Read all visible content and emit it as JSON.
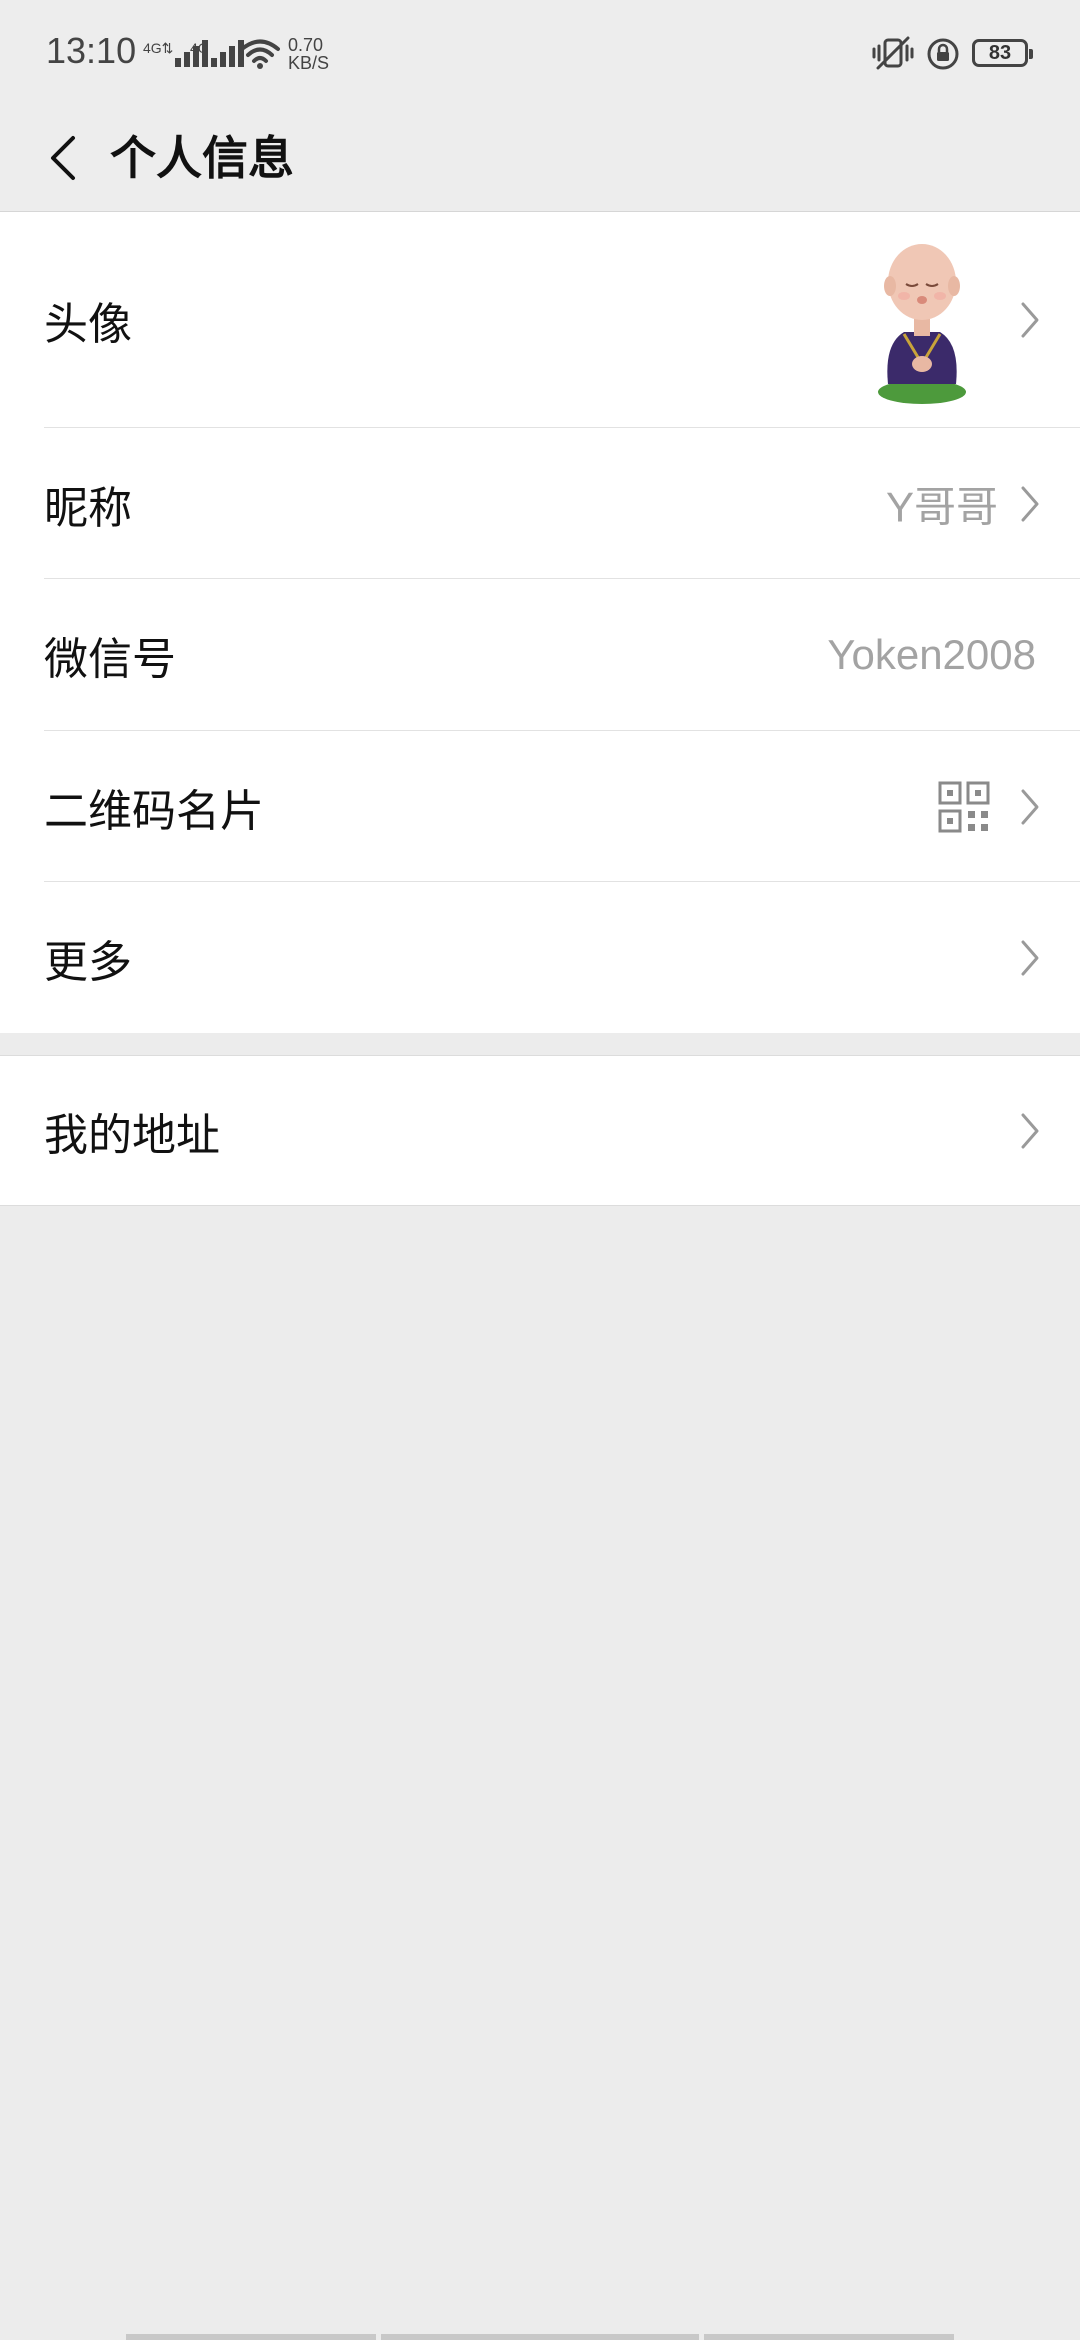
{
  "status_bar": {
    "time": "13:10",
    "signal_1_label": "4G⇅",
    "signal_2_label": "4G",
    "net_speed_value": "0.70",
    "net_speed_unit": "KB/S",
    "battery_level": "83",
    "icons": [
      "wifi-icon",
      "vibrate-icon",
      "rotation-lock-icon",
      "battery-icon"
    ]
  },
  "header": {
    "title": "个人信息",
    "back_icon": "back-arrow-icon"
  },
  "profile_section": {
    "rows": [
      {
        "label": "头像",
        "value": "",
        "type": "avatar",
        "icon": "avatar-image"
      },
      {
        "label": "昵称",
        "value": "Y哥哥",
        "type": "text"
      },
      {
        "label": "微信号",
        "value": "Yoken2008",
        "type": "text"
      },
      {
        "label": "二维码名片",
        "value": "",
        "type": "qr",
        "icon": "qr-code-icon"
      },
      {
        "label": "更多",
        "value": "",
        "type": "link"
      }
    ]
  },
  "address_section": {
    "rows": [
      {
        "label": "我的地址",
        "value": "",
        "type": "link"
      }
    ]
  },
  "colors": {
    "background": "#ececec",
    "card": "#ffffff",
    "secondary_text": "#a3a3a3",
    "divider": "#e2e2e2"
  }
}
